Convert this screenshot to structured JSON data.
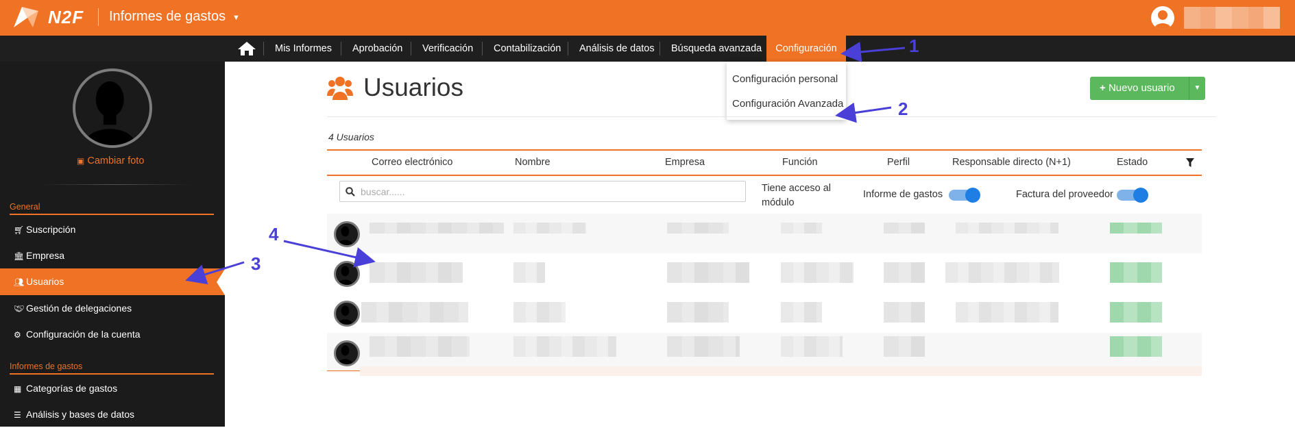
{
  "app": {
    "logo_text": "N2F",
    "title": "Informes de gastos"
  },
  "nav": {
    "items": [
      {
        "label": "Mis Informes"
      },
      {
        "label": "Aprobación"
      },
      {
        "label": "Verificación"
      },
      {
        "label": "Contabilización"
      },
      {
        "label": "Análisis de datos"
      },
      {
        "label": "Búsqueda avanzada"
      },
      {
        "label": "Configuración",
        "active": true
      }
    ],
    "dropdown": [
      {
        "label": "Configuración personal"
      },
      {
        "label": "Configuración Avanzada"
      }
    ]
  },
  "sidebar": {
    "change_photo": "Cambiar foto",
    "sections": [
      {
        "title": "General",
        "items": [
          {
            "label": "Suscripción",
            "icon": "cart-icon"
          },
          {
            "label": "Empresa",
            "icon": "bank-icon"
          },
          {
            "label": "Usuarios",
            "icon": "users-icon",
            "active": true
          },
          {
            "label": "Gestión de delegaciones",
            "icon": "handshake-icon"
          },
          {
            "label": "Configuración de la cuenta",
            "icon": "gears-icon"
          }
        ]
      },
      {
        "title": "Informes de gastos",
        "items": [
          {
            "label": "Categorías de gastos",
            "icon": "grid-icon"
          },
          {
            "label": "Análisis y bases de datos",
            "icon": "list-icon"
          }
        ]
      }
    ]
  },
  "main": {
    "title": "Usuarios",
    "new_user_label": "Nuevo usuario",
    "count_label": "4 Usuarios",
    "columns": [
      "Correo electrónico",
      "Nombre",
      "Empresa",
      "Función",
      "Perfil",
      "Responsable directo (N+1)",
      "Estado"
    ],
    "search_placeholder": "buscar......",
    "module_access_label": "Tiene acceso al módulo",
    "toggle_expense_label": "Informe de gastos",
    "toggle_expense_on": true,
    "toggle_supplier_label": "Factura del proveedor",
    "toggle_supplier_on": true,
    "rows_count": 4
  },
  "annotations": [
    "1",
    "2",
    "3",
    "4"
  ],
  "colors": {
    "brand_orange": "#ef7225",
    "nav_dark": "#1f1f1f",
    "success_green": "#5cb85c",
    "toggle_blue": "#1e7ee4",
    "annotation_blue": "#4a3fd6"
  }
}
